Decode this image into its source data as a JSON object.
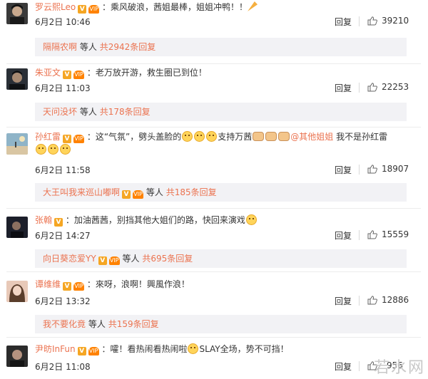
{
  "common": {
    "reply_label": "回复",
    "others_text": "等人",
    "vip_text": "VIP"
  },
  "comments": [
    {
      "username": "罗云熙Leo",
      "text": "：乘风破浪，茜姐最棒，姐姐冲鸭！！",
      "date": "6月2日",
      "time": "10:46",
      "likes": "39210",
      "sub_user": "隔隔农啊",
      "sub_count": "共2942条回复",
      "avatar_color": "#3a3a3a"
    },
    {
      "username": "朱亚文",
      "text": "：老万放开游，救生圈已到位！",
      "date": "6月2日",
      "time": "11:03",
      "likes": "22253",
      "sub_user": "天问没坏",
      "sub_count": "共178条回复",
      "avatar_color": "#2a2f36"
    },
    {
      "username": "孙红雷",
      "text_a": "：这“气氛”，劈头盖脸的",
      "text_b": "支持万茜",
      "mention": "@其他姐姐",
      "text_c": " 我不是孙红雷",
      "date": "6月2日",
      "time": "11:58",
      "likes": "18907",
      "sub_user": "大王叫我来巡山嘟啊",
      "sub_count": "共185条回复",
      "avatar_color": "#8fb4c8"
    },
    {
      "username": "张翰",
      "text": "：加油茜茜，别挡其他大姐们的路，快回来演戏",
      "date": "6月2日",
      "time": "14:27",
      "likes": "15559",
      "sub_user": "向日葵恋爱YY",
      "sub_count": "共695条回复",
      "avatar_color": "#1c1f2a"
    },
    {
      "username": "谭维维",
      "text": "：來呀，浪啊！興風作浪！",
      "date": "6月2日",
      "time": "13:32",
      "likes": "12886",
      "sub_user": "我不要化竟",
      "sub_count": "共159条回复",
      "avatar_color": "#e8c9b8"
    },
    {
      "username": "尹昉InFun",
      "text_a": "：嚯！看热闹看热闹啦",
      "text_b": "SLAY全场，势不可挡！",
      "date": "6月2日",
      "time": "11:08",
      "likes": "956",
      "avatar_color": "#2b2b2b"
    }
  ],
  "watermark": "若水网"
}
